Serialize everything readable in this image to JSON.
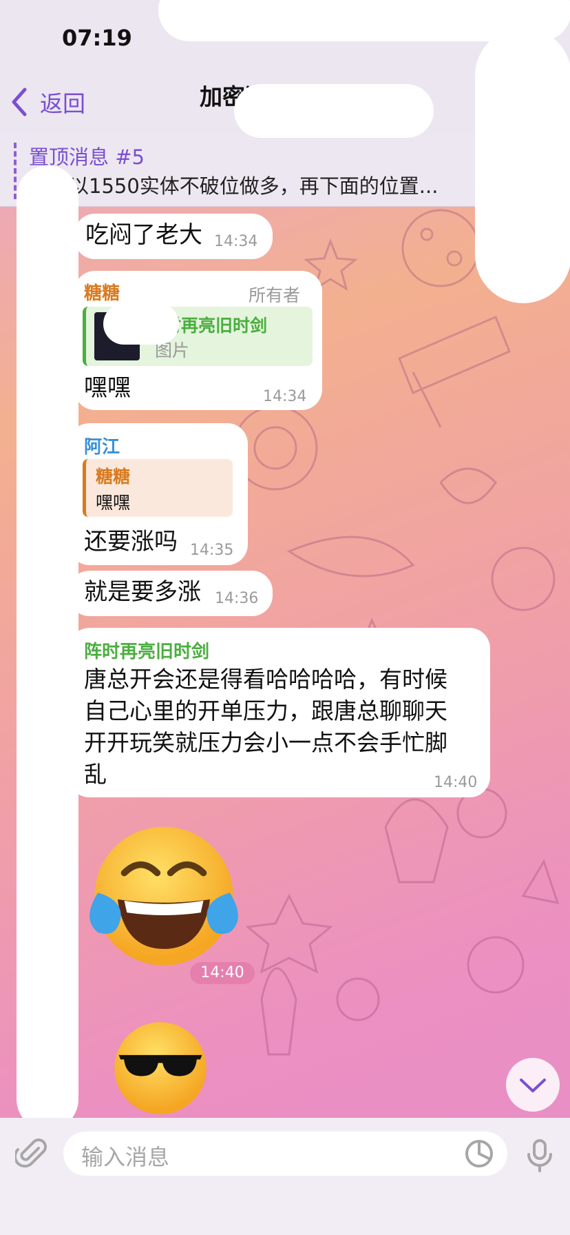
{
  "status": {
    "time": "07:19"
  },
  "nav": {
    "back_label": "返回",
    "title": "加密酒馆交流群"
  },
  "pinned": {
    "title": "置顶消息 #5",
    "text": "还是以1550实体不破位做多，再下面的位置..."
  },
  "messages": [
    {
      "text": "吃闷了老大",
      "time": "14:34"
    },
    {
      "sender": "糖糖",
      "role": "所有者",
      "reply_sender": "阵时再亮旧时剑",
      "reply_text": "图片",
      "text": "嘿嘿",
      "time": "14:34"
    },
    {
      "sender": "阿江",
      "reply_sender": "糖糖",
      "reply_text": "嘿嘿",
      "text": "还要涨吗",
      "time": "14:35"
    },
    {
      "text": "就是要多涨",
      "time": "14:36"
    },
    {
      "sender": "阵时再亮旧时剑",
      "lines": [
        "唐总开会还是得看哈哈哈哈，有时候",
        "自己心里的开单压力，跟唐总聊聊天",
        "开开玩笑就压力会小一点不会手忙脚",
        "乱"
      ],
      "time": "14:40"
    },
    {
      "time": "14:40"
    }
  ],
  "input": {
    "placeholder": "输入消息"
  },
  "colors": {
    "accent": "#7a4fd0",
    "sender_orange": "#d97a1f",
    "sender_blue": "#3a8fd8",
    "sender_green": "#4aae3e",
    "time_chip": "#e47fae"
  }
}
